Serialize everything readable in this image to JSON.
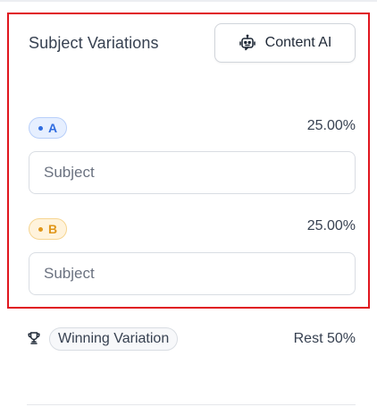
{
  "panel": {
    "title": "Subject Variations",
    "ai_button": {
      "label": "Content AI",
      "icon": "robot-icon"
    }
  },
  "variations": [
    {
      "badge": "A",
      "percent": "25.00%",
      "placeholder": "Subject",
      "value": "",
      "color": "#2f6ce0"
    },
    {
      "badge": "B",
      "percent": "25.00%",
      "placeholder": "Subject",
      "value": "",
      "color": "#e0961a"
    }
  ],
  "winning": {
    "icon": "trophy-icon",
    "label": "Winning Variation",
    "rest": "Rest 50%"
  },
  "colors": {
    "highlight_border": "#e0161e",
    "text": "#374151"
  }
}
